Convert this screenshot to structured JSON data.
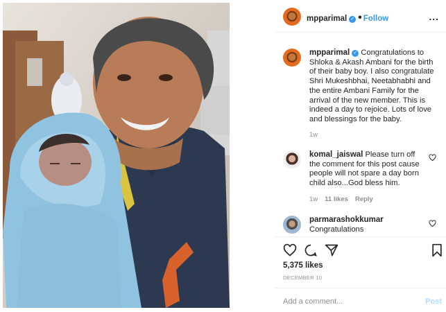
{
  "post": {
    "photo_alt": "",
    "author": {
      "username": "mpparimal",
      "verified": true,
      "follow_label": "Follow",
      "separator": "•",
      "more_label": "..."
    }
  },
  "comments": [
    {
      "username": "mpparimal",
      "verified": true,
      "text": "Congratulations to Shloka & Akash Ambani for the birth of their baby boy. I also congratulate Shri Mukeshbhai, Neetabhabhi and the entire Ambani Family for the arrival of the new member. This is indeed a day to rejoice. Lots of love and blessings for the baby.",
      "time": "1w"
    },
    {
      "username": "komal_jaiswal",
      "text": "Please turn off the comment for this post cause people will not spare a day born child also...God bless him.",
      "time": "1w",
      "likes": "11 likes",
      "reply": "Reply"
    },
    {
      "username": "parmarashokkumar",
      "text": "Congratulations"
    }
  ],
  "stats": {
    "likes": "5,375 likes",
    "date": "DECEMBER 10"
  },
  "composer": {
    "placeholder": "Add a comment...",
    "post_label": "Post"
  },
  "icons": {
    "like": "heart-icon",
    "comment": "comment-icon",
    "share": "share-icon",
    "save": "bookmark-icon",
    "verified": "verified-badge-icon",
    "more": "more-options-icon"
  },
  "colors": {
    "accent": "#3897f0",
    "muted": "#8e8e8e",
    "text": "#262626"
  }
}
